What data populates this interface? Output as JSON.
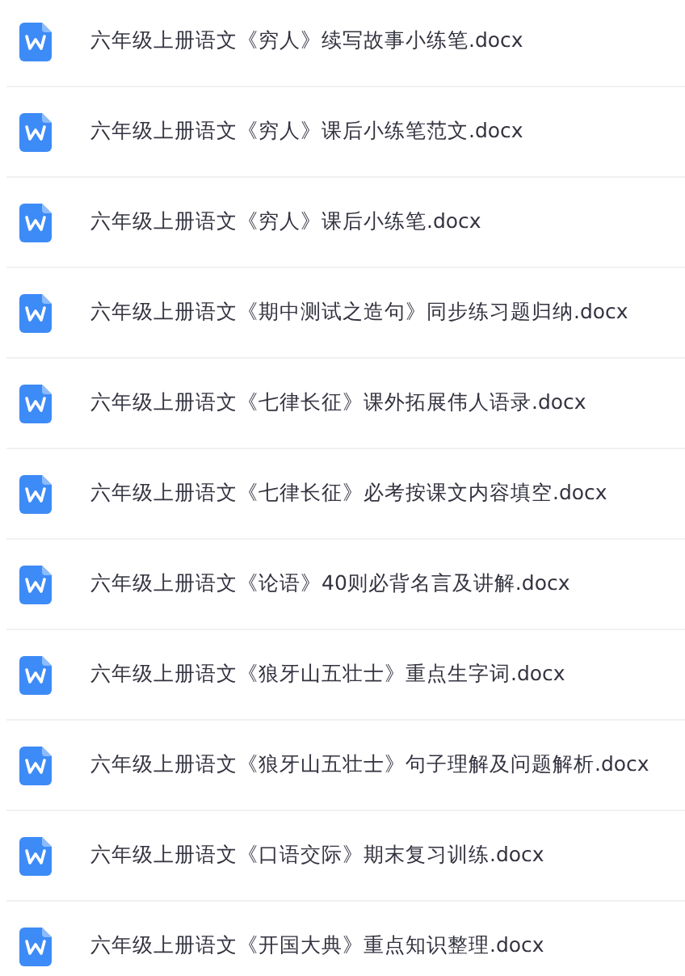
{
  "files": [
    {
      "name": "六年级上册语文《穷人》续写故事小练笔.docx"
    },
    {
      "name": "六年级上册语文《穷人》课后小练笔范文.docx"
    },
    {
      "name": "六年级上册语文《穷人》课后小练笔.docx"
    },
    {
      "name": "六年级上册语文《期中测试之造句》同步练习题归纳.docx"
    },
    {
      "name": "六年级上册语文《七律长征》课外拓展伟人语录.docx"
    },
    {
      "name": "六年级上册语文《七律长征》必考按课文内容填空.docx"
    },
    {
      "name": "六年级上册语文《论语》40则必背名言及讲解.docx"
    },
    {
      "name": "六年级上册语文《狼牙山五壮士》重点生字词.docx"
    },
    {
      "name": "六年级上册语文《狼牙山五壮士》句子理解及问题解析.docx"
    },
    {
      "name": "六年级上册语文《口语交际》期末复习训练.docx"
    },
    {
      "name": "六年级上册语文《开国大典》重点知识整理.docx"
    }
  ]
}
